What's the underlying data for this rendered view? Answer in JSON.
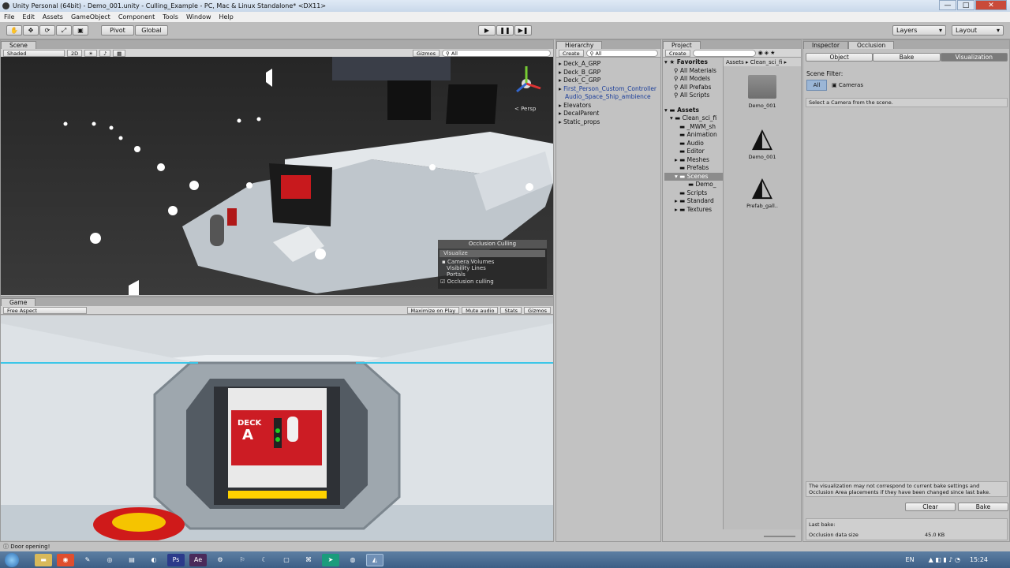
{
  "window": {
    "title": "Unity Personal (64bit) - Demo_001.unity - Culling_Example - PC, Mac & Linux Standalone* <DX11>",
    "minimize": "—",
    "maximize": "□",
    "close": "✕"
  },
  "menu": [
    "File",
    "Edit",
    "Assets",
    "GameObject",
    "Component",
    "Tools",
    "Window",
    "Help"
  ],
  "toolbar": {
    "pivot": "Pivot",
    "global": "Global",
    "layers": "Layers",
    "layout": "Layout"
  },
  "scene": {
    "tab": "Scene",
    "shading": "Shaded",
    "mode2d": "2D",
    "gizmos": "Gizmos",
    "search_placeholder": "All",
    "persp": "< Persp",
    "occlusion_overlay": {
      "title": "Occlusion Culling",
      "visualize": "Visualize",
      "items": [
        "Camera Volumes",
        "Visibility Lines",
        "Portals"
      ],
      "checkbox": "Occlusion culling"
    }
  },
  "game": {
    "tab": "Game",
    "aspect": "Free Aspect",
    "maximize": "Maximize on Play",
    "mute": "Mute audio",
    "stats": "Stats",
    "gizmos": "Gizmos",
    "door_line1": "DECK",
    "door_line2": "A"
  },
  "hierarchy": {
    "tab": "Hierarchy",
    "create": "Create",
    "search_placeholder": "All",
    "items": [
      {
        "label": "Deck_A_GRP",
        "blue": false
      },
      {
        "label": "Deck_B_GRP",
        "blue": false
      },
      {
        "label": "Deck_C_GRP",
        "blue": false
      },
      {
        "label": "First_Person_Custom_Controller",
        "blue": true
      },
      {
        "label": "Audio_Space_Ship_ambience",
        "blue": true
      },
      {
        "label": "Elevators",
        "blue": false
      },
      {
        "label": "DecalParent",
        "blue": false
      },
      {
        "label": "Static_props",
        "blue": false
      }
    ]
  },
  "project": {
    "tab": "Project",
    "create": "Create",
    "favorites_label": "Favorites",
    "favorites": [
      "All Materials",
      "All Models",
      "All Prefabs",
      "All Scripts"
    ],
    "assets_label": "Assets",
    "assets_root": "Clean_sci_fi",
    "folders": [
      "_MWM_sh",
      "Animation",
      "Audio",
      "Editor",
      "Meshes",
      "Prefabs",
      "Scenes",
      "Demo_",
      "Scripts",
      "Standard",
      "Textures"
    ],
    "breadcrumb": "Assets ▸ Clean_sci_fi ▸",
    "grid": [
      {
        "name": "Demo_001",
        "kind": "folder"
      },
      {
        "name": "Demo_001",
        "kind": "unity"
      },
      {
        "name": "Prefab_gall..",
        "kind": "unity"
      }
    ]
  },
  "inspector": {
    "tab_inspector": "Inspector",
    "tab_occlusion": "Occlusion",
    "subtabs": [
      "Object",
      "Bake",
      "Visualization"
    ],
    "active_subtab": "Visualization",
    "scene_filter": "Scene Filter:",
    "filter_all": "All",
    "filter_cameras": "Cameras",
    "hint": "Select a Camera from the scene.",
    "warning": "The visualization may not correspond to current bake settings and Occlusion Area placements if they have been changed since last bake.",
    "clear": "Clear",
    "bake": "Bake",
    "last_bake": "Last bake:",
    "size_label": "Occlusion data size",
    "size_value": "45.0 KB"
  },
  "status": {
    "text": "Door opening!"
  },
  "taskbar": {
    "lang": "EN",
    "time": "15:24"
  }
}
